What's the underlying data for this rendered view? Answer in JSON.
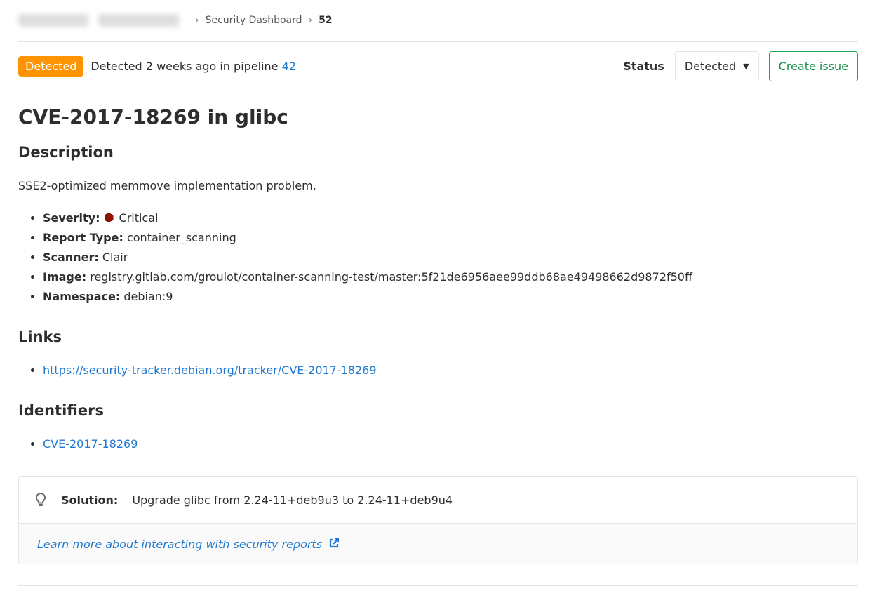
{
  "breadcrumb": {
    "items": [
      "Security Dashboard",
      "52"
    ]
  },
  "header": {
    "badge": "Detected",
    "detected_text": "Detected 2 weeks ago in pipeline",
    "pipeline": "42",
    "status_label": "Status",
    "status_value": "Detected",
    "create_issue": "Create issue",
    "badge_color": "#fc9403"
  },
  "title": "CVE-2017-18269 in glibc",
  "description": {
    "heading": "Description",
    "text": "SSE2-optimized memmove implementation problem.",
    "items": [
      {
        "label": "Severity:",
        "value": "Critical",
        "icon": "severity-critical-icon"
      },
      {
        "label": "Report Type:",
        "value": "container_scanning"
      },
      {
        "label": "Scanner:",
        "value": "Clair"
      },
      {
        "label": "Image:",
        "value": "registry.gitlab.com/groulot/container-scanning-test/master:5f21de6956aee99ddb68ae49498662d9872f50ff"
      },
      {
        "label": "Namespace:",
        "value": "debian:9"
      }
    ]
  },
  "links": {
    "heading": "Links",
    "items": [
      "https://security-tracker.debian.org/tracker/CVE-2017-18269"
    ]
  },
  "identifiers": {
    "heading": "Identifiers",
    "items": [
      "CVE-2017-18269"
    ]
  },
  "solution": {
    "label": "Solution:",
    "text": "Upgrade glibc from 2.24-11+deb9u3 to 2.24-11+deb9u4",
    "learn_more": "Learn more about interacting with security reports"
  }
}
